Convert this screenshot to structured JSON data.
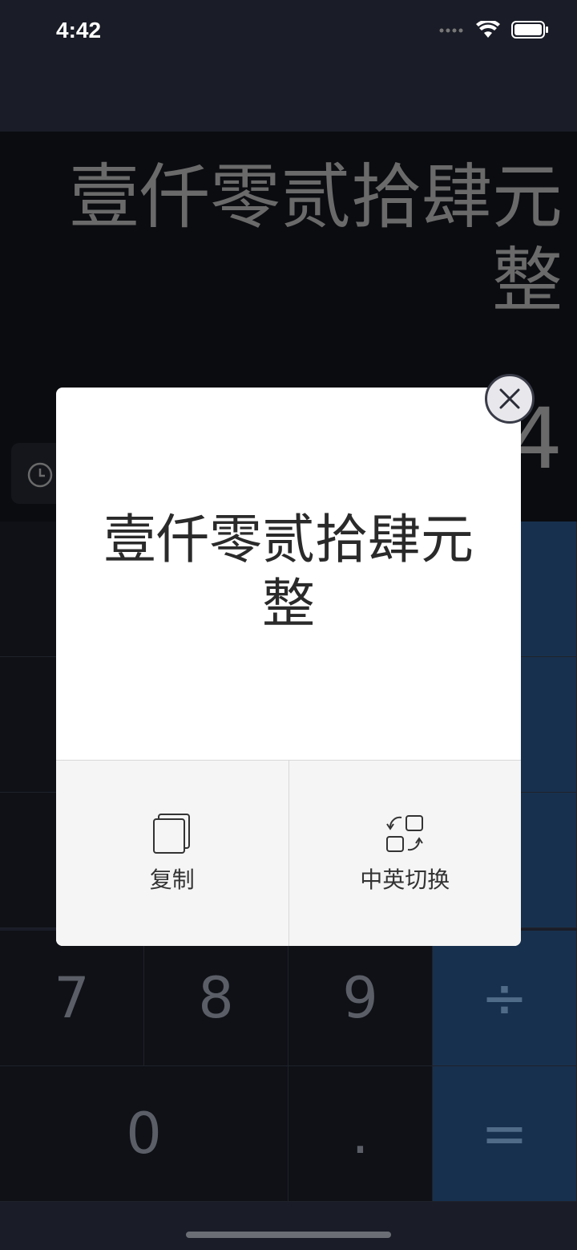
{
  "status_bar": {
    "time": "4:42"
  },
  "display": {
    "result": "壹仟零贰拾肆元整",
    "input": "4"
  },
  "keypad": {
    "keys": [
      "7",
      "8",
      "9",
      "÷",
      "0",
      ".",
      "="
    ]
  },
  "modal": {
    "text": "壹仟零贰拾肆元整",
    "copy_label": "复制",
    "switch_label": "中英切换"
  },
  "colors": {
    "operator_key": "#17304e",
    "display_bg": "#0b0c10",
    "modal_bg": "#ffffff"
  }
}
